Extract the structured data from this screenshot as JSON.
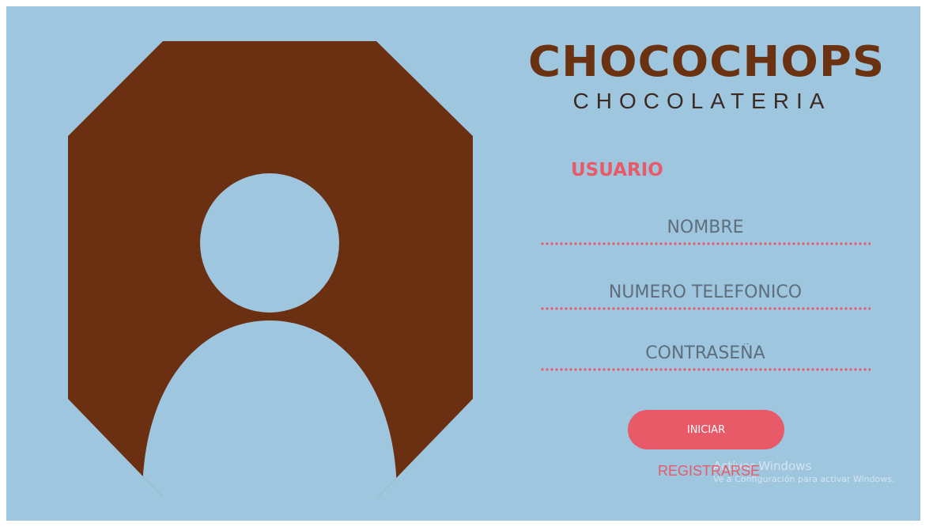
{
  "brand": {
    "name": "CHOCOCHOPS",
    "tagline": "CHOCOLATERIA",
    "color": "#6b3212"
  },
  "avatar": {
    "icon": "user-avatar-icon",
    "frame_color": "#6b2f12"
  },
  "form": {
    "title": "USUARIO",
    "fields": [
      {
        "name": "nombre",
        "placeholder": "NOMBRE",
        "value": ""
      },
      {
        "name": "telefono",
        "placeholder": "NUMERO TELEFONICO",
        "value": ""
      },
      {
        "name": "contrasena",
        "placeholder": "CONTRASEÑA",
        "value": ""
      }
    ],
    "submit_label": "INICIAR",
    "register_label": "REGISTRARSE"
  },
  "watermark": {
    "title": "Activar Windows",
    "subtitle": "Ve a Configuración para activar Windows."
  },
  "colors": {
    "background": "#9fc6df",
    "accent": "#e85a68",
    "input_text": "#5e6e7c"
  }
}
